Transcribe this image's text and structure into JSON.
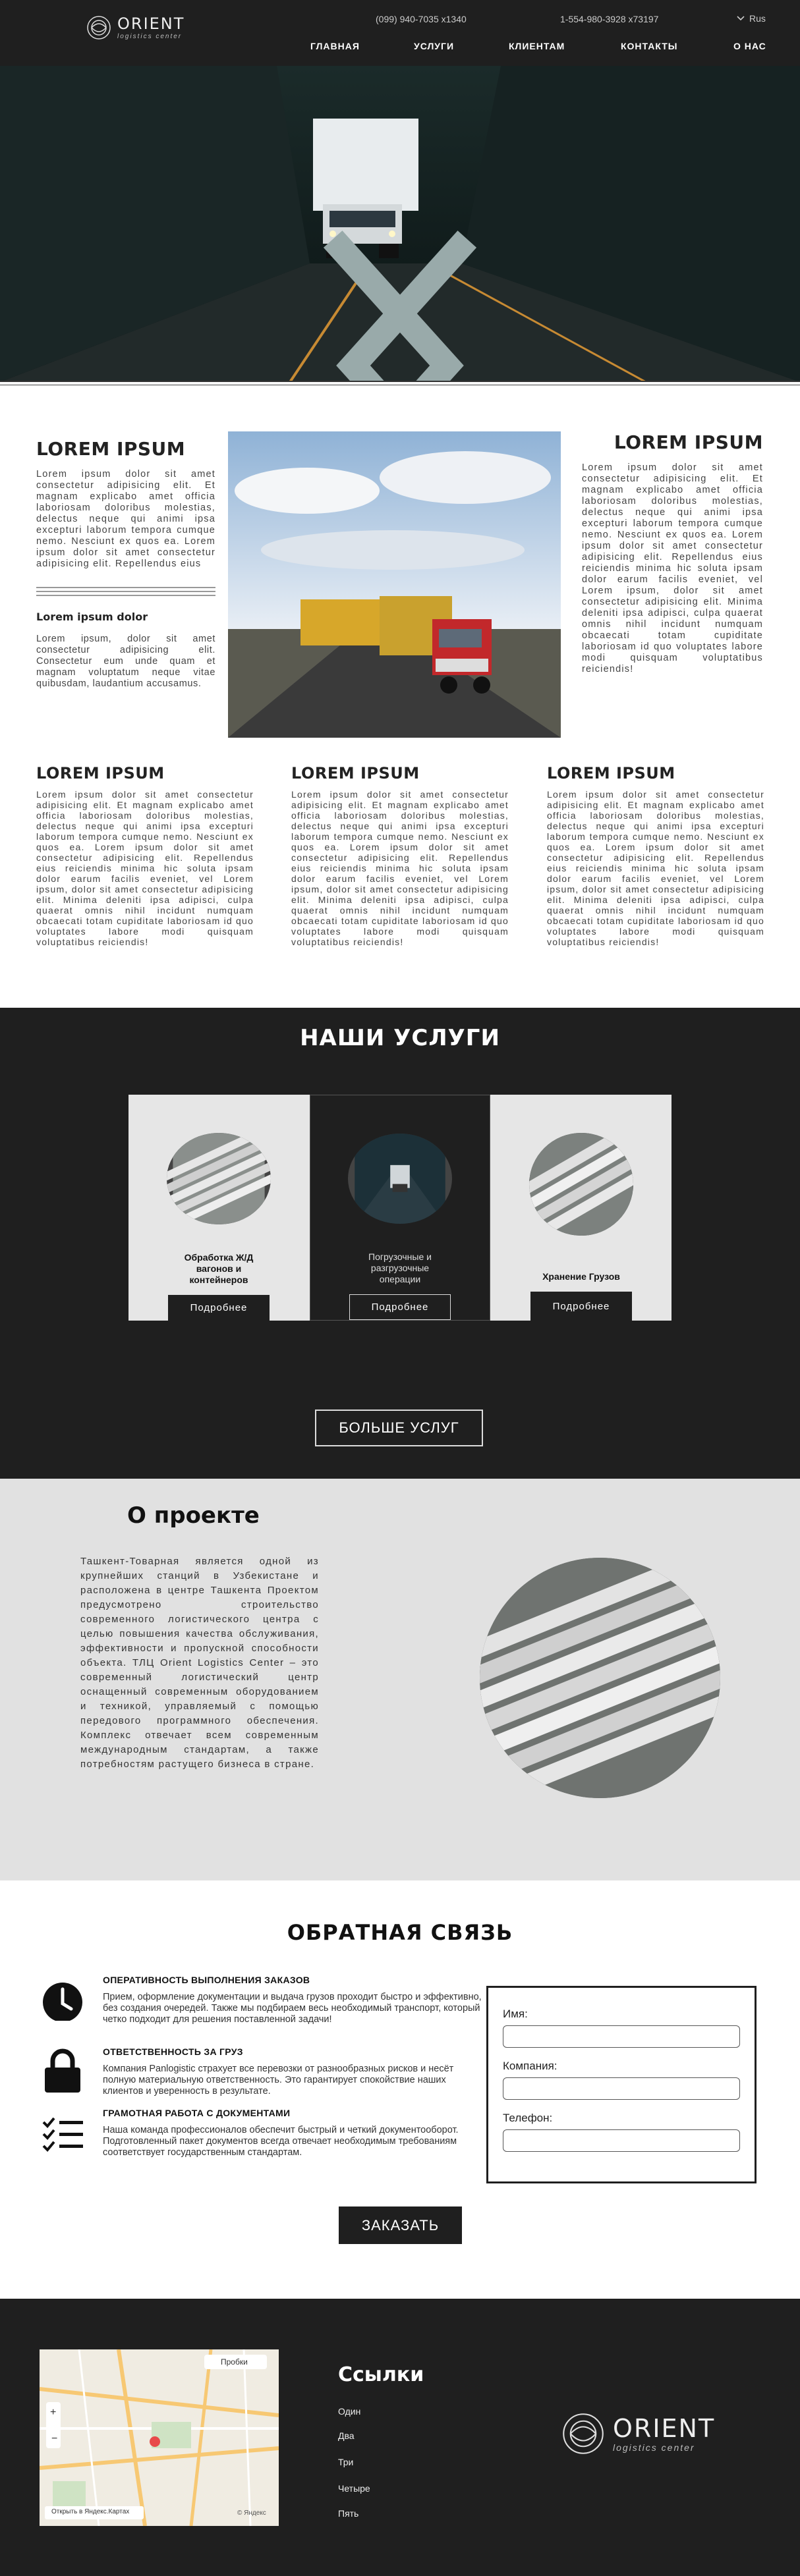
{
  "header": {
    "logo_name": "ORIENT",
    "logo_sub": "logistics center",
    "phone1": "(099) 940-7035 x1340",
    "phone2": "1-554-980-3928 x73197",
    "lang": "Rus",
    "nav": [
      "ГЛАВНАЯ",
      "УСЛУГИ",
      "КЛИЕНТАМ",
      "КОНТАКТЫ",
      "О НАС"
    ]
  },
  "intro": {
    "left_title": "LOREM IPSUM",
    "left_text": "Lorem ipsum dolor sit amet consectetur adipisicing elit. Et magnam explicabo amet officia laboriosam doloribus molestias, delectus neque qui animi ipsa excepturi laborum tempora cumque nemo. Nesciunt ex quos ea. Lorem ipsum dolor sit amet consectetur adipisicing elit. Repellendus eius",
    "left_sub": "Lorem ipsum dolor",
    "left_sub_text": "Lorem ipsum, dolor sit amet consectetur adipisicing elit. Consectetur eum unde quam et magnam voluptatum neque vitae quibusdam, laudantium accusamus.",
    "right_title": "LOREM IPSUM",
    "right_text": "Lorem ipsum dolor sit amet consectetur adipisicing elit. Et magnam explicabo amet officia laboriosam doloribus molestias, delectus neque qui animi ipsa excepturi laborum tempora cumque nemo. Nesciunt ex quos ea. Lorem ipsum dolor sit amet consectetur adipisicing elit. Repellendus eius reiciendis minima hic soluta ipsam dolor earum facilis eveniet, vel Lorem ipsum, dolor sit amet consectetur adipisicing elit. Minima deleniti ipsa adipisci, culpa quaerat omnis nihil incidunt numquam obcaecati totam cupiditate laboriosam id quo voluptates labore modi quisquam voluptatibus reiciendis!",
    "columns": [
      {
        "title": "LOREM IPSUM",
        "text": "Lorem ipsum dolor sit amet consectetur adipisicing elit. Et magnam explicabo amet officia laboriosam doloribus molestias, delectus neque qui animi ipsa excepturi laborum tempora cumque nemo. Nesciunt ex quos ea. Lorem ipsum dolor sit amet consectetur adipisicing elit. Repellendus eius reiciendis minima hic soluta ipsam dolor earum facilis eveniet, vel Lorem ipsum, dolor sit amet consectetur adipisicing elit. Minima deleniti ipsa adipisci, culpa quaerat omnis nihil incidunt numquam obcaecati totam cupiditate laboriosam id quo voluptates labore modi quisquam voluptatibus reiciendis!"
      },
      {
        "title": "LOREM IPSUM",
        "text": "Lorem ipsum dolor sit amet consectetur adipisicing elit. Et magnam explicabo amet officia laboriosam doloribus molestias, delectus neque qui animi ipsa excepturi laborum tempora cumque nemo. Nesciunt ex quos ea. Lorem ipsum dolor sit amet consectetur adipisicing elit. Repellendus eius reiciendis minima hic soluta ipsam dolor earum facilis eveniet, vel Lorem ipsum, dolor sit amet consectetur adipisicing elit. Minima deleniti ipsa adipisci, culpa quaerat omnis nihil incidunt numquam obcaecati totam cupiditate laboriosam id quo voluptates labore modi quisquam voluptatibus reiciendis!"
      },
      {
        "title": "LOREM IPSUM",
        "text": "Lorem ipsum dolor sit amet consectetur adipisicing elit. Et magnam explicabo amet officia laboriosam doloribus molestias, delectus neque qui animi ipsa excepturi laborum tempora cumque nemo. Nesciunt ex quos ea. Lorem ipsum dolor sit amet consectetur adipisicing elit. Repellendus eius reiciendis minima hic soluta ipsam dolor earum facilis eveniet, vel Lorem ipsum, dolor sit amet consectetur adipisicing elit. Minima deleniti ipsa adipisci, culpa quaerat omnis nihil incidunt numquam obcaecati totam cupiditate laboriosam id quo voluptates labore modi quisquam voluptatibus reiciendis!"
      }
    ]
  },
  "services": {
    "title": "НАШИ УСЛУГИ",
    "cards": [
      {
        "label": "Обработка Ж/Д вагонов и контейнеров",
        "button": "Подробнее"
      },
      {
        "label": "Погрузочные и разгрузочные операции",
        "button": "Подробнее"
      },
      {
        "label": "Хранение Грузов",
        "button": "Подробнее"
      }
    ],
    "more_button": "БОЛЬШЕ УСЛУГ"
  },
  "project": {
    "title": "О проекте",
    "text": "Ташкент-Товарная является одной из крупнейших станций в Узбекистане и расположена в центре Ташкента Проектом предусмотрено строительство современного логистического центра с целью повышения качества обслуживания, эффективности и пропускной способности объекта. ТЛЦ Orient Logistics Center – это современный логистический центр оснащенный современным оборудованием и техникой, управляемый с помощью передового программного обеспечения. Комплекс отвечает всем современным международным стандартам, а также потребностям растущего бизнеса в стране."
  },
  "feedback": {
    "title": "ОБРАТНАЯ СВЯЗЬ",
    "features": [
      {
        "icon": "clock-icon",
        "head": "ОПЕРАТИВНОСТЬ ВЫПОЛНЕНИЯ ЗАКАЗОВ",
        "body": "Прием, оформление документации и выдача грузов проходит быстро и эффективно, без создания очередей. Также мы подбираем весь необходимый транспорт, который четко подходит для решения поставленной задачи!"
      },
      {
        "icon": "lock-icon",
        "head": "ОТВЕТСТВЕННОСТЬ ЗА ГРУЗ",
        "body": "Компания Panlogistic страхует все перевозки от разнообразных рисков и несёт полную материальную ответственность. Это гарантирует спокойствие наших клиентов и уверенность в результате."
      },
      {
        "icon": "checklist-icon",
        "head": "ГРАМОТНАЯ РАБОТА С ДОКУМЕНТАМИ",
        "body": "Наша команда профессионалов обеспечит быстрый и четкий документооборот. Подготовленный пакет документов всегда отвечает необходимым требованиям соответствует государственным стандартам."
      }
    ],
    "form": {
      "name_label": "Имя:",
      "company_label": "Компания:",
      "phone_label": "Телефон:",
      "name_value": "",
      "company_value": "",
      "phone_value": ""
    },
    "order_button": "ЗАКАЗАТЬ"
  },
  "footer": {
    "links_title": "Ссылки",
    "links": [
      "Один",
      "Два",
      "Три",
      "Четыре",
      "Пять"
    ],
    "map_labels": {
      "probki": "Пробки",
      "open_link": "Открыть в Яндекс.Картах",
      "copyright": "© Яндекс"
    },
    "logo_name": "ORIENT",
    "logo_sub": "logistics center"
  }
}
